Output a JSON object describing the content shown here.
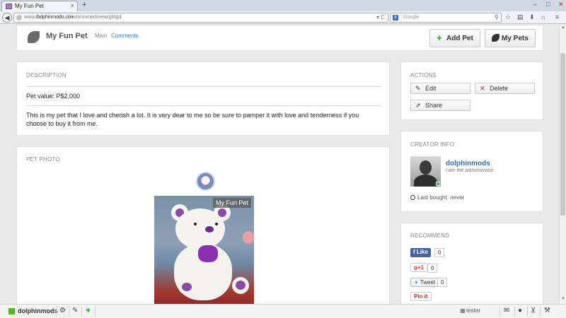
{
  "browser": {
    "tab_title": "My Fun Pet",
    "tab_close": "×",
    "new_tab": "+",
    "url_prefix": "www.",
    "url_domain": "dolphinmods.com",
    "url_path": "/m/owned/view/gfdgd",
    "url_controls": "▾ C",
    "search_placeholder": "Google",
    "search_engine": "8",
    "window_controls": {
      "minimize": "–",
      "maximize": "□",
      "close": "✕"
    }
  },
  "header": {
    "site_title": "My Fun Pet",
    "nav": {
      "main": "Main",
      "comments": "Comments"
    },
    "add_pet": "Add Pet",
    "my_pets": "My Pets"
  },
  "description": {
    "title": "DESCRIPTION",
    "price": "Pet value: P$2,000",
    "text": "This is my pet that I love and cherish a lot. It is very dear to me so be sure to pamper it with love and tenderness if you choose to buy it from me."
  },
  "photo": {
    "title": "PET PHOTO",
    "caption": "My Fun Pet"
  },
  "actions": {
    "title": "ACTIONS",
    "edit": "Edit",
    "delete": "Delete",
    "share": "Share"
  },
  "creator": {
    "title": "CREATOR INFO",
    "name": "dolphinmods",
    "subtitle": "I am the administrator",
    "last_bought": "Last bought: never"
  },
  "recommend": {
    "title": "RECOMMEND",
    "facebook": "Like",
    "facebook_count": "0",
    "gplus": "+1",
    "gplus_count": "0",
    "twitter": "Tweet",
    "twitter_count": "0",
    "pinterest": "Pin it"
  },
  "bottombar": {
    "user": "dolphinmods",
    "tester": "tester"
  },
  "colors": {
    "accent_blue": "#2a83c3",
    "add_green": "#1a9e2a",
    "delete_red": "#d01818",
    "facebook": "#4463a6",
    "online": "#3cb43c"
  }
}
